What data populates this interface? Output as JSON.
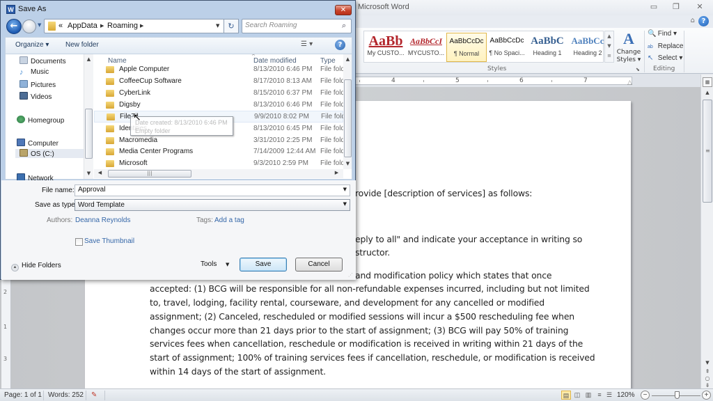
{
  "word": {
    "title": "Microsoft Word",
    "window_controls": {
      "minimize": "▭",
      "restore": "❐",
      "close": "✕"
    },
    "ribbon": {
      "help_label": "?",
      "minimize_ribbon_label": "⌂",
      "styles": [
        {
          "sample": "AaBb",
          "label": "My CUSTO...",
          "color": "#b3262c"
        },
        {
          "sample": "AaBbCcI",
          "label": "MYCUSTO...",
          "color": "#b3262c"
        },
        {
          "sample": "AaBbCcDc",
          "label": "¶ Normal",
          "color": "#111111",
          "selected": true
        },
        {
          "sample": "AaBbCcDc",
          "label": "¶ No Spaci...",
          "color": "#111111"
        },
        {
          "sample": "AaBbC",
          "label": "Heading 1",
          "color": "#365f91"
        },
        {
          "sample": "AaBbCc",
          "label": "Heading 2",
          "color": "#4f81bd"
        }
      ],
      "gallery_scroll": [
        "▲",
        "▼",
        "≡"
      ],
      "change_styles": {
        "icon": "A",
        "label": "Change Styles ▾"
      },
      "styles_group_label": "Styles",
      "editing": {
        "find": {
          "icon": "🔍",
          "label": "Find ▾"
        },
        "replace": {
          "icon": "ab",
          "label": "Replace"
        },
        "select": {
          "icon": "↖",
          "label": "Select ▾"
        },
        "group_label": "Editing"
      }
    },
    "ruler": {
      "numbers": [
        "4",
        "5",
        "6",
        "7"
      ],
      "vertical_numbers": [
        "2",
        "1",
        "3"
      ]
    },
    "document": {
      "lines": [
        "rovide [description of services] as follows:",
        "eply to all\" and indicate your acceptance in writing so",
        "structor.",
        "and modification policy which states that once",
        "accepted: (1) BCG will be responsible for all non-refundable expenses incurred, including but not limited",
        "to, travel, lodging, facility rental, courseware, and development for any cancelled or modified",
        "assignment; (2) Canceled, rescheduled or modified sessions will incur a $500 rescheduling fee when",
        "changes occur more than 21 days prior to the start of assignment; (3) BCG will pay 50% of training",
        "services fees when cancellation, reschedule or modification is received in writing within 21 days of the",
        "start of assignment; 100% of training services fees if cancellation, reschedule, or modification is received",
        "within 14 days of the start of assignment."
      ]
    },
    "statusbar": {
      "page": "Page: 1 of 1",
      "words": "Words: 252",
      "proofing_icon": "✎",
      "views": [
        "▤",
        "◫",
        "▥",
        "≡",
        "☰"
      ],
      "zoom": "120%",
      "zoom_percent": 120,
      "zoom_out": "−",
      "zoom_in": "+"
    },
    "vscroll": {
      "up": "▲",
      "down": "▼",
      "browse": [
        "⇞",
        "○",
        "⇟"
      ]
    }
  },
  "dialog": {
    "title": "Save As",
    "app_icon": "W",
    "close": "✕",
    "nav": {
      "back": "←",
      "breadcrumb": [
        "AppData",
        "Roaming"
      ],
      "breadcrumb_prefix": "«",
      "refresh": "↻",
      "search_placeholder": "Search Roaming",
      "search_icon": "⌕"
    },
    "toolbar": {
      "organize": "Organize ▾",
      "new_folder": "New folder",
      "views": "☰ ▾",
      "help": "?"
    },
    "nav_pane": [
      {
        "label": "Documents",
        "color": "#c9d4e2"
      },
      {
        "label": "Music",
        "color": "#4a8fd4"
      },
      {
        "label": "Pictures",
        "color": "#8fb2d9"
      },
      {
        "label": "Videos",
        "color": "#4d6d95"
      },
      {
        "label": "Homegroup",
        "color": "#3f8f57"
      },
      {
        "label": "Computer",
        "color": "#4f78b8"
      },
      {
        "label": "OS (C:)",
        "color": "#b9a46a",
        "selected": true
      },
      {
        "label": "Network",
        "color": "#3c6fae"
      }
    ],
    "columns": {
      "name": "Name",
      "date": "Date modified",
      "type": "Type",
      "sort_indicator": "^"
    },
    "files": [
      {
        "name": "Apple Computer",
        "date": "8/13/2010 6:46 PM",
        "type": "File folder"
      },
      {
        "name": "CoffeeCup Software",
        "date": "8/17/2010 8:13 AM",
        "type": "File folder"
      },
      {
        "name": "CyberLink",
        "date": "8/15/2010 6:37 PM",
        "type": "File folder"
      },
      {
        "name": "Digsby",
        "date": "8/13/2010 6:46 PM",
        "type": "File folder"
      },
      {
        "name": "FileZilla",
        "date": "9/9/2010 8:02 PM",
        "type": "File folder",
        "hover": true
      },
      {
        "name": "Identities",
        "date": "8/13/2010 6:45 PM",
        "type": "File folder"
      },
      {
        "name": "Macromedia",
        "date": "3/31/2010 2:25 PM",
        "type": "File folder"
      },
      {
        "name": "Media Center Programs",
        "date": "7/14/2009 12:44 AM",
        "type": "File folder"
      },
      {
        "name": "Microsoft",
        "date": "9/3/2010 2:59 PM",
        "type": "File folder"
      }
    ],
    "file_name_display": "FileZil",
    "tooltip": {
      "line1": "Date created: 8/13/2010 6:46 PM",
      "line2": "Empty folder"
    },
    "form": {
      "file_name_label": "File name:",
      "file_name_value": "Approval",
      "save_as_type_label": "Save as type:",
      "save_as_type_value": "Word Template",
      "authors_label": "Authors:",
      "authors_value": "Deanna Reynolds",
      "tags_label": "Tags:",
      "tags_value": "Add a tag",
      "save_thumbnail_label": "Save Thumbnail",
      "save_thumbnail_checked": false
    },
    "footer": {
      "hide_folders": "Hide Folders",
      "tools": "Tools",
      "save": "Save",
      "cancel": "Cancel"
    }
  }
}
